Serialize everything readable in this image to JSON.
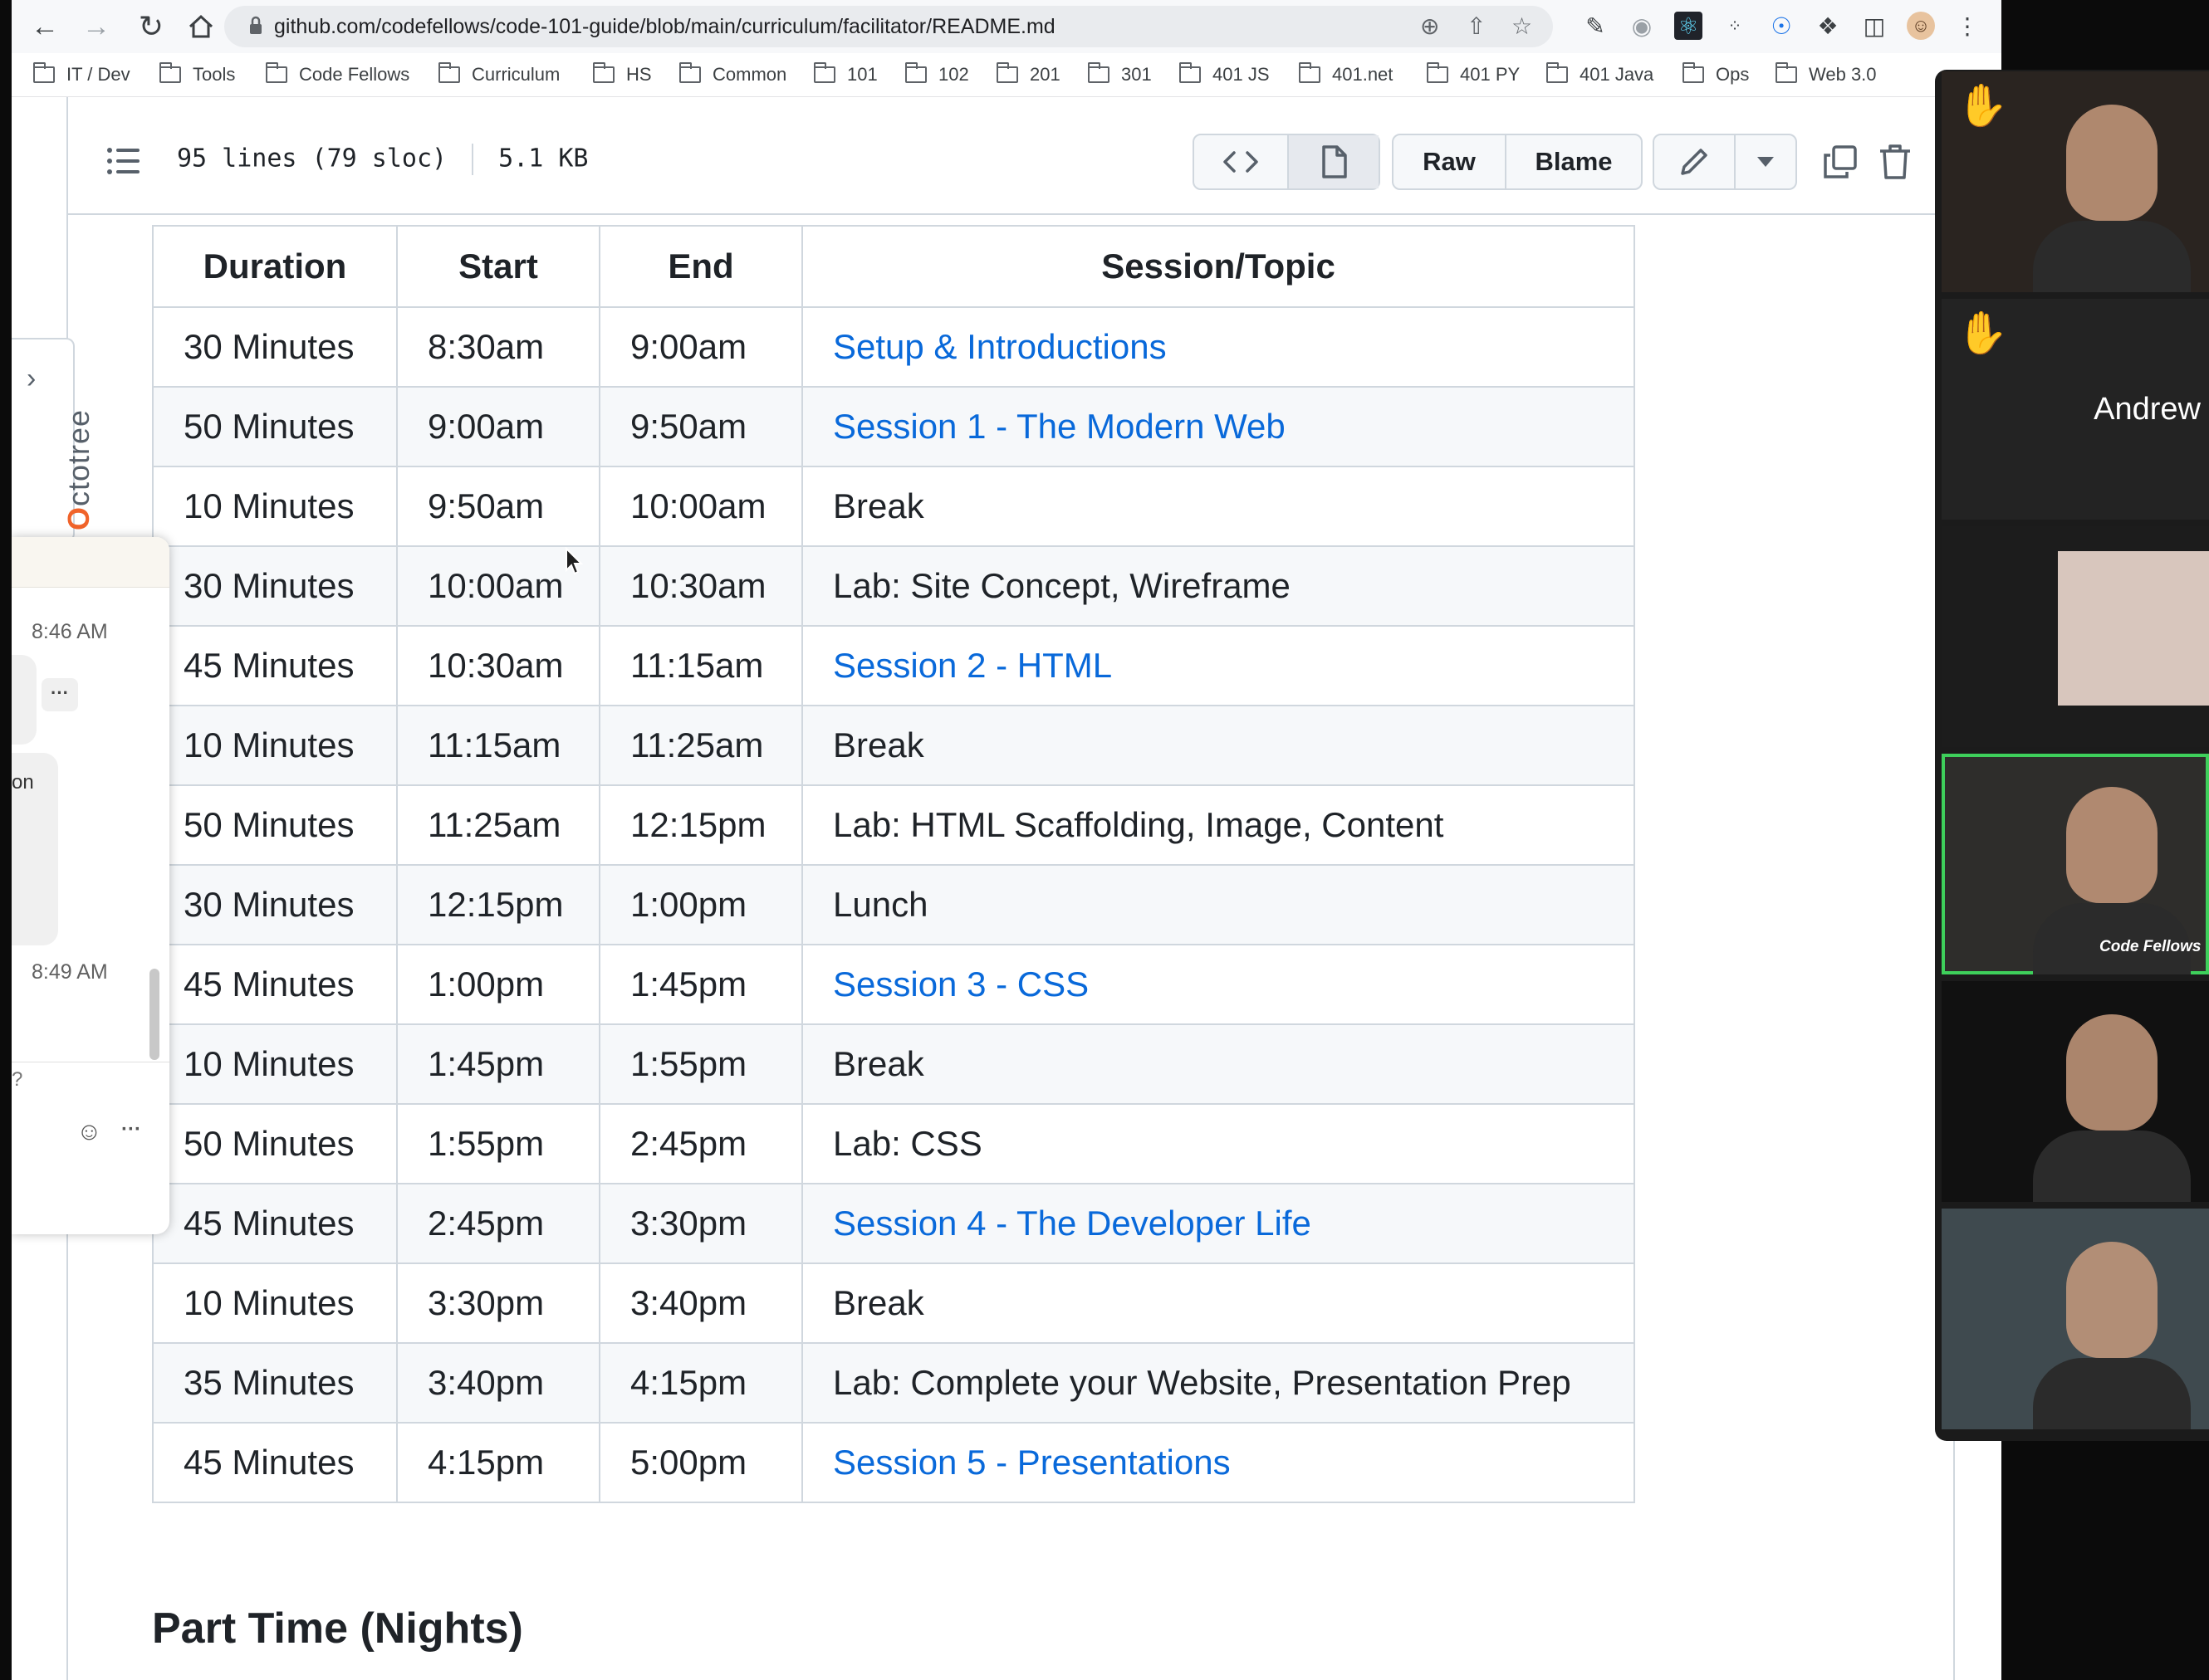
{
  "browser": {
    "url": "github.com/codefellows/code-101-guide/blob/main/curriculum/facilitator/README.md",
    "bookmarks": [
      {
        "label": "IT / Dev"
      },
      {
        "label": "Tools"
      },
      {
        "label": "Code Fellows"
      },
      {
        "label": "Curriculum"
      },
      {
        "label": "HS"
      },
      {
        "label": "Common"
      },
      {
        "label": "101"
      },
      {
        "label": "102"
      },
      {
        "label": "201"
      },
      {
        "label": "301"
      },
      {
        "label": "401 JS"
      },
      {
        "label": "401.net"
      },
      {
        "label": "401 PY"
      },
      {
        "label": "401 Java"
      },
      {
        "label": "Ops"
      },
      {
        "label": "Web 3.0"
      }
    ]
  },
  "file_header": {
    "lines": "95 lines (79 sloc)",
    "size": "5.1 KB",
    "raw_label": "Raw",
    "blame_label": "Blame"
  },
  "octotree": {
    "label_first": "O",
    "label_rest": "ctotree"
  },
  "table": {
    "headers": [
      "Duration",
      "Start",
      "End",
      "Session/Topic"
    ],
    "rows": [
      {
        "duration": "30 Minutes",
        "start": "8:30am",
        "end": "9:00am",
        "topic": "Setup & Introductions",
        "is_link": true
      },
      {
        "duration": "50 Minutes",
        "start": "9:00am",
        "end": "9:50am",
        "topic": "Session 1 - The Modern Web",
        "is_link": true
      },
      {
        "duration": "10 Minutes",
        "start": "9:50am",
        "end": "10:00am",
        "topic": "Break",
        "is_link": false
      },
      {
        "duration": "30 Minutes",
        "start": "10:00am",
        "end": "10:30am",
        "topic": "Lab: Site Concept, Wireframe",
        "is_link": false
      },
      {
        "duration": "45 Minutes",
        "start": "10:30am",
        "end": "11:15am",
        "topic": "Session 2 - HTML",
        "is_link": true
      },
      {
        "duration": "10 Minutes",
        "start": "11:15am",
        "end": "11:25am",
        "topic": "Break",
        "is_link": false
      },
      {
        "duration": "50 Minutes",
        "start": "11:25am",
        "end": "12:15pm",
        "topic": "Lab: HTML Scaffolding, Image, Content",
        "is_link": false
      },
      {
        "duration": "30 Minutes",
        "start": "12:15pm",
        "end": "1:00pm",
        "topic": "Lunch",
        "is_link": false
      },
      {
        "duration": "45 Minutes",
        "start": "1:00pm",
        "end": "1:45pm",
        "topic": "Session 3 - CSS",
        "is_link": true
      },
      {
        "duration": "10 Minutes",
        "start": "1:45pm",
        "end": "1:55pm",
        "topic": "Break",
        "is_link": false
      },
      {
        "duration": "50 Minutes",
        "start": "1:55pm",
        "end": "2:45pm",
        "topic": "Lab: CSS",
        "is_link": false
      },
      {
        "duration": "45 Minutes",
        "start": "2:45pm",
        "end": "3:30pm",
        "topic": "Session 4 - The Developer Life",
        "is_link": true
      },
      {
        "duration": "10 Minutes",
        "start": "3:30pm",
        "end": "3:40pm",
        "topic": "Break",
        "is_link": false
      },
      {
        "duration": "35 Minutes",
        "start": "3:40pm",
        "end": "4:15pm",
        "topic": "Lab: Complete your Website, Presentation Prep",
        "is_link": false
      },
      {
        "duration": "45 Minutes",
        "start": "4:15pm",
        "end": "5:00pm",
        "topic": "Session 5 - Presentations",
        "is_link": true
      }
    ]
  },
  "section_heading": "Part Time (Nights)",
  "chat": {
    "time_1": "8:46 AM",
    "time_2": "8:49 AM",
    "fragment_1": "on",
    "fragment_2": "?",
    "more": "···"
  },
  "video": {
    "tiles": [
      {
        "name": "",
        "hand_raised": true,
        "talking": false,
        "bg": "#2a2420"
      },
      {
        "name": "Andrew",
        "hand_raised": true,
        "talking": false,
        "bg": "#232323"
      },
      {
        "name": "",
        "hand_raised": false,
        "talking": false,
        "bg": "#1c1c1c"
      },
      {
        "name": "",
        "hand_raised": false,
        "talking": true,
        "bg": "#2e2d2b",
        "shirt_text": "Code Fellows"
      },
      {
        "name": "",
        "hand_raised": false,
        "talking": false,
        "bg": "#111111"
      },
      {
        "name": "",
        "hand_raised": false,
        "talking": false,
        "bg": "#3f4a4f"
      }
    ]
  },
  "colors": {
    "link": "#0969da",
    "border": "#d0d7de",
    "talking_outline": "#3ecf5b"
  }
}
